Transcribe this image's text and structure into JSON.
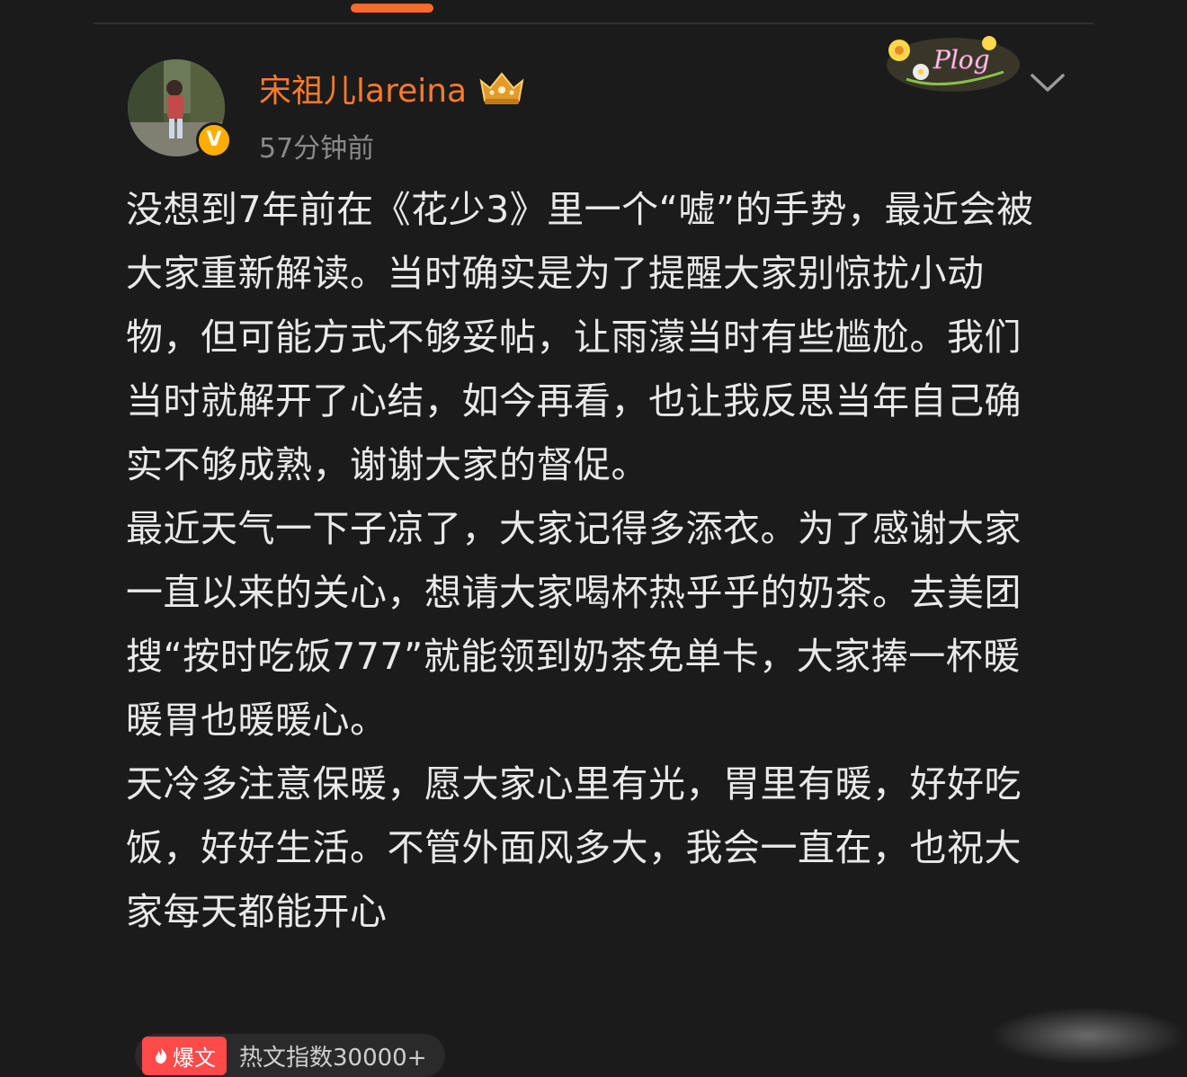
{
  "header": {
    "username": "宋祖儿lareina",
    "timestamp": "57分钟前"
  },
  "icons": {
    "crown": "crown-icon",
    "verified": "verified-v-icon",
    "sticker": "plog-sticker-icon",
    "menu": "chevron-down-icon",
    "fire": "fire-icon"
  },
  "verified_badge_letter": "V",
  "sticker_text": "Plog",
  "post": {
    "paragraphs": [
      "没想到7年前在《花少3》里一个“嘘”的手势，最近会被大家重新解读。当时确实是为了提醒大家别惊扰小动物，但可能方式不够妥帖，让雨濛当时有些尴尬。我们当时就解开了心结，如今再看，也让我反思当年自己确实不够成熟，谢谢大家的督促。",
      "最近天气一下子凉了，大家记得多添衣。为了感谢大家一直以来的关心，想请大家喝杯热乎乎的奶茶。去美团搜“按时吃饭777”就能领到奶茶免单卡，大家捧一杯暖暖胃也暖暖心。",
      "天冷多注意保暖，愿大家心里有光，胃里有暖，好好吃饭，好好生活。不管外面风多大，我会一直在，也祝大家每天都能开心"
    ]
  },
  "hot": {
    "badge": "爆文",
    "label": "热文指数30000+"
  },
  "colors": {
    "background": "#1b1b1b",
    "username": "#ff7a2a",
    "accent_tab": "#ff6a2a",
    "timestamp": "#8a8a8a",
    "body_text": "#e9e9e9",
    "verified": "#ffae00",
    "hot_badge": "#ff4a4a"
  }
}
